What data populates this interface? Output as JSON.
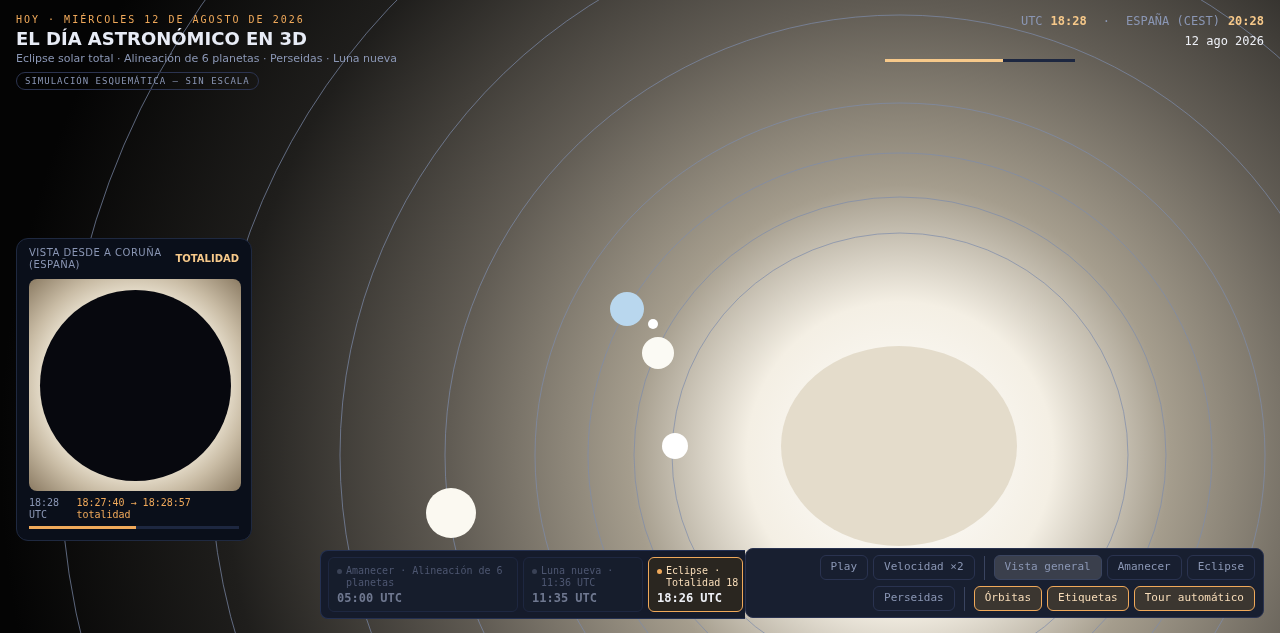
{
  "header": {
    "date_line": "HOY · MIÉRCOLES 12 DE AGOSTO DE 2026",
    "title": "EL DÍA ASTRONÓMICO EN 3D",
    "subtitle": "Eclipse solar total · Alineación de 6 planetas · Perseidas · Luna nueva",
    "badge": "SIMULACIÓN ESQUEMÁTICA — SIN ESCALA"
  },
  "clock": {
    "utc_label": "UTC",
    "utc_time": "18:28",
    "separator": "·",
    "local_label": "ESPAÑA (CEST)",
    "local_time": "20:28",
    "date": "12 ago 2026",
    "level": 0.62
  },
  "eclipse_view": {
    "title": "VISTA DESDE A CORUÑA (ESPAÑA)",
    "phase": "TOTALIDAD",
    "time": "18:28 UTC",
    "range": "18:27:40 → 18:28:57 totalidad",
    "level": 0.51
  },
  "timeline": [
    {
      "label": "Amanecer · Alineación de 6 planetas",
      "time": "05:00 UTC",
      "selected": false
    },
    {
      "label": "Luna nueva · 11:36 UTC",
      "time": "11:35 UTC",
      "selected": false
    },
    {
      "label": "Eclipse · Totalidad 18",
      "time": "18:26 UTC",
      "selected": true
    }
  ],
  "controls": {
    "row_1": [
      {
        "kind": "action",
        "label": "Play"
      },
      {
        "kind": "action",
        "label": "Velocidad ×2"
      },
      {
        "kind": "divider"
      },
      {
        "kind": "view",
        "label": "Vista general",
        "selected": true
      },
      {
        "kind": "view",
        "label": "Amanecer",
        "selected": false
      },
      {
        "kind": "view",
        "label": "Eclipse",
        "selected": false
      }
    ],
    "row_2": [
      {
        "kind": "view",
        "label": "Perseidas",
        "selected": false
      },
      {
        "kind": "divider"
      },
      {
        "kind": "toggle",
        "label": "Órbitas",
        "on": true
      },
      {
        "kind": "toggle",
        "label": "Etiquetas",
        "on": true
      },
      {
        "kind": "toggle",
        "label": "Tour automático",
        "on": true
      }
    ]
  }
}
